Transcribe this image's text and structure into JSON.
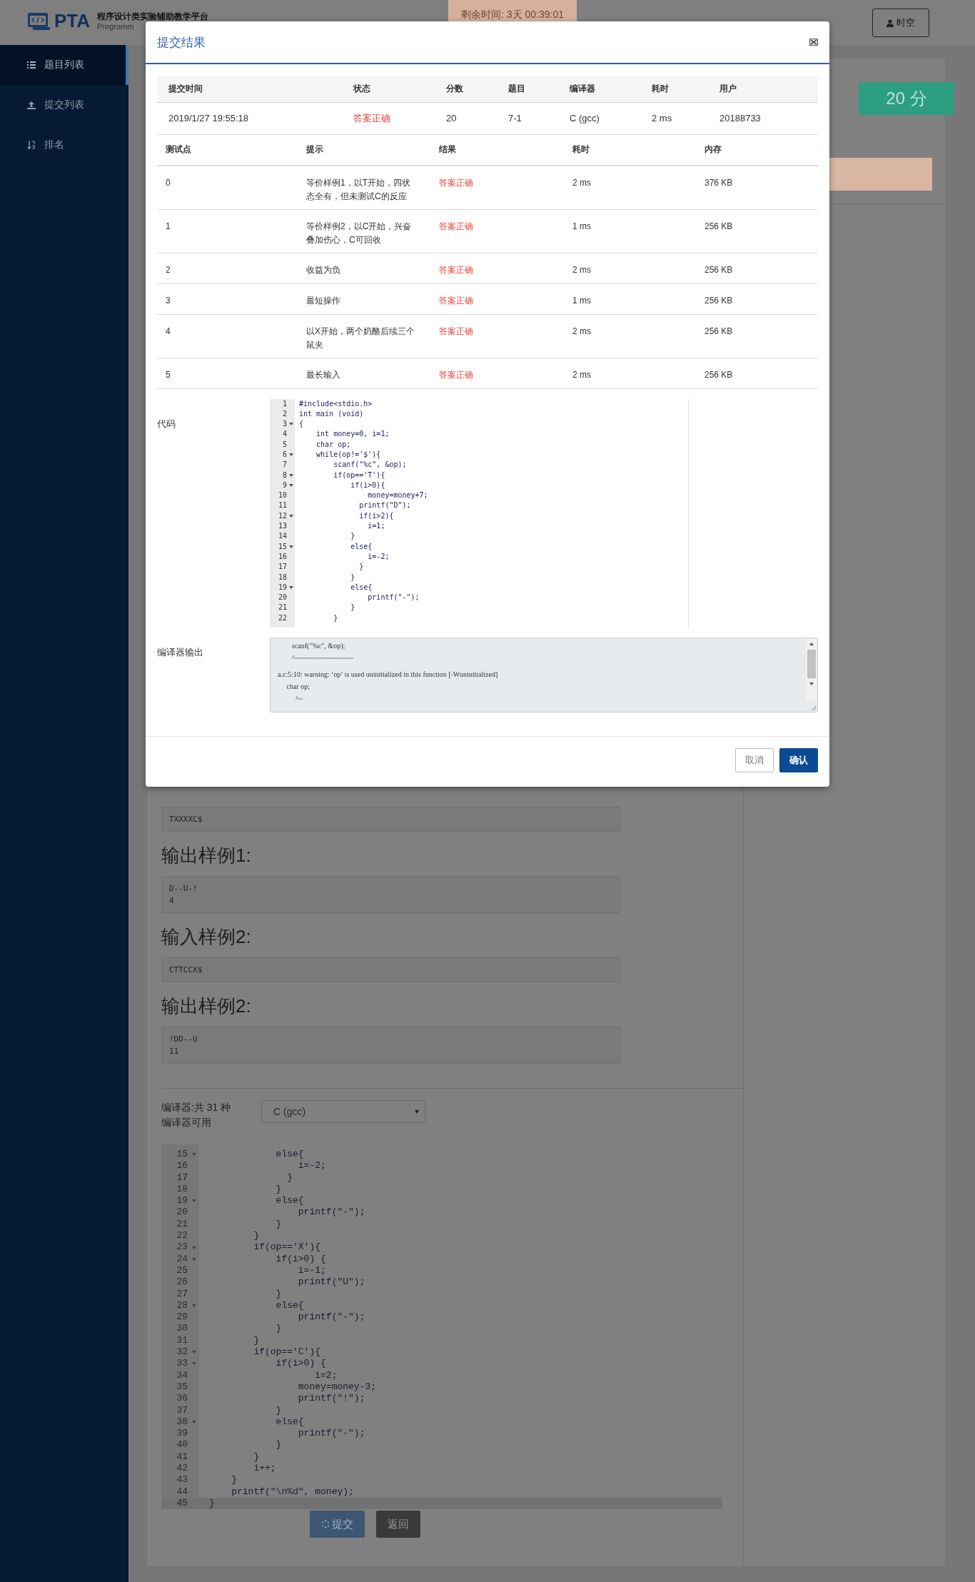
{
  "header": {
    "logo": "PTA",
    "subtitle": "程序设计类实验辅助教学平台",
    "subtitle_en": "Programm",
    "timer": "剩余时间: 3天 00:39:01",
    "user": "时空"
  },
  "sidebar": {
    "items": [
      {
        "label": "题目列表",
        "kind": "list",
        "selected": true
      },
      {
        "label": "提交列表",
        "kind": "upload",
        "selected": false
      },
      {
        "label": "排名",
        "kind": "rank",
        "selected": false
      }
    ]
  },
  "score_badge": "20 分",
  "samples": [
    {
      "kind": "box",
      "lines": [
        "TXXXXC$"
      ]
    },
    {
      "kind": "heading",
      "text": "输出样例1:"
    },
    {
      "kind": "box",
      "lines": [
        "D--U-!",
        "4"
      ]
    },
    {
      "kind": "heading",
      "text": "输入样例2:"
    },
    {
      "kind": "box",
      "lines": [
        "CTTCCX$"
      ]
    },
    {
      "kind": "heading",
      "text": "输出样例2:"
    },
    {
      "kind": "box",
      "lines": [
        "!DD--U",
        "11"
      ]
    }
  ],
  "compiler": {
    "label": "编译器:共 31 种编译器可用",
    "value": "C (gcc)"
  },
  "editor": {
    "lines": [
      {
        "n": "15",
        "fold": true,
        "active": false,
        "code": "            else{"
      },
      {
        "n": "16",
        "fold": false,
        "active": false,
        "code": "                i=-2;"
      },
      {
        "n": "17",
        "fold": false,
        "active": false,
        "code": "              }"
      },
      {
        "n": "18",
        "fold": false,
        "active": false,
        "code": "            }"
      },
      {
        "n": "19",
        "fold": true,
        "active": false,
        "code": "            else{"
      },
      {
        "n": "20",
        "fold": false,
        "active": false,
        "code": "                printf(\"-\");"
      },
      {
        "n": "21",
        "fold": false,
        "active": false,
        "code": "            }"
      },
      {
        "n": "22",
        "fold": false,
        "active": false,
        "code": "        }"
      },
      {
        "n": "23",
        "fold": true,
        "active": false,
        "code": "        if(op=='X'){"
      },
      {
        "n": "24",
        "fold": true,
        "active": false,
        "code": "            if(i>0) {"
      },
      {
        "n": "25",
        "fold": false,
        "active": false,
        "code": "                i=-1;"
      },
      {
        "n": "26",
        "fold": false,
        "active": false,
        "code": "                printf(\"U\");"
      },
      {
        "n": "27",
        "fold": false,
        "active": false,
        "code": "            }"
      },
      {
        "n": "28",
        "fold": true,
        "active": false,
        "code": "            else{"
      },
      {
        "n": "29",
        "fold": false,
        "active": false,
        "code": "                printf(\"-\");"
      },
      {
        "n": "30",
        "fold": false,
        "active": false,
        "code": "            }"
      },
      {
        "n": "31",
        "fold": false,
        "active": false,
        "code": "        }"
      },
      {
        "n": "32",
        "fold": true,
        "active": false,
        "code": "        if(op=='C'){"
      },
      {
        "n": "33",
        "fold": true,
        "active": false,
        "code": "            if(i>0) {"
      },
      {
        "n": "34",
        "fold": false,
        "active": false,
        "code": "                   i=2;"
      },
      {
        "n": "35",
        "fold": false,
        "active": false,
        "code": "                money=money-3;"
      },
      {
        "n": "36",
        "fold": false,
        "active": false,
        "code": "                printf(\"!\");"
      },
      {
        "n": "37",
        "fold": false,
        "active": false,
        "code": "            }"
      },
      {
        "n": "38",
        "fold": true,
        "active": false,
        "code": "            else{"
      },
      {
        "n": "39",
        "fold": false,
        "active": false,
        "code": "                printf(\"-\");"
      },
      {
        "n": "40",
        "fold": false,
        "active": false,
        "code": "            }"
      },
      {
        "n": "41",
        "fold": false,
        "active": false,
        "code": "        }"
      },
      {
        "n": "42",
        "fold": false,
        "active": false,
        "code": "        i++;"
      },
      {
        "n": "43",
        "fold": false,
        "active": false,
        "code": "    }"
      },
      {
        "n": "44",
        "fold": false,
        "active": false,
        "code": "    printf(\"\\n%d\", money);"
      },
      {
        "n": "45",
        "fold": false,
        "active": true,
        "code": "}"
      }
    ]
  },
  "buttons": [
    {
      "label": "提交",
      "kind": "primary"
    },
    {
      "label": "返回",
      "kind": "secondary"
    }
  ],
  "modal": {
    "title": "提交结果",
    "summary": {
      "columns": [
        "提交时间",
        "状态",
        "分数",
        "题目",
        "编译器",
        "耗时",
        "用户"
      ],
      "row": [
        "2019/1/27 19:55:18",
        "答案正确",
        "20",
        "7-1",
        "C (gcc)",
        "2 ms",
        "20188733"
      ]
    },
    "tests": {
      "columns": [
        "测试点",
        "提示",
        "结果",
        "耗时",
        "内存"
      ],
      "rows": [
        [
          "0",
          "等价样例1，以T开始，四状态全有，但未测试C的反应",
          "答案正确",
          "2 ms",
          "376 KB"
        ],
        [
          "1",
          "等价样例2，以C开始，兴奋叠加伤心，C可回收",
          "答案正确",
          "1 ms",
          "256 KB"
        ],
        [
          "2",
          "收益为负",
          "答案正确",
          "2 ms",
          "256 KB"
        ],
        [
          "3",
          "最短操作",
          "答案正确",
          "1 ms",
          "256 KB"
        ],
        [
          "4",
          "以X开始，两个奶酪后续三个鼠夹",
          "答案正确",
          "2 ms",
          "256 KB"
        ],
        [
          "5",
          "最长输入",
          "答案正确",
          "2 ms",
          "256 KB"
        ]
      ]
    },
    "code_label": "代码",
    "code": [
      {
        "n": "1",
        "fold": false,
        "code": "#include<stdio.h>"
      },
      {
        "n": "2",
        "fold": false,
        "code": "int main (void)"
      },
      {
        "n": "3",
        "fold": true,
        "code": "{"
      },
      {
        "n": "4",
        "fold": false,
        "code": "    int money=0, i=1;"
      },
      {
        "n": "5",
        "fold": false,
        "code": "    char op;"
      },
      {
        "n": "6",
        "fold": true,
        "code": "    while(op!='$'){"
      },
      {
        "n": "7",
        "fold": false,
        "code": "        scanf(\"%c\", &op);"
      },
      {
        "n": "8",
        "fold": true,
        "code": "        if(op=='T'){"
      },
      {
        "n": "9",
        "fold": true,
        "code": "            if(i>0){"
      },
      {
        "n": "10",
        "fold": false,
        "code": "                money=money+7;"
      },
      {
        "n": "11",
        "fold": false,
        "code": "              printf(\"D\");"
      },
      {
        "n": "12",
        "fold": true,
        "code": "              if(i>2){"
      },
      {
        "n": "13",
        "fold": false,
        "code": "                i=1;"
      },
      {
        "n": "14",
        "fold": false,
        "code": "            }"
      },
      {
        "n": "15",
        "fold": true,
        "code": "            else{"
      },
      {
        "n": "16",
        "fold": false,
        "code": "                i=-2;"
      },
      {
        "n": "17",
        "fold": false,
        "code": "              }"
      },
      {
        "n": "18",
        "fold": false,
        "code": "            }"
      },
      {
        "n": "19",
        "fold": true,
        "code": "            else{"
      },
      {
        "n": "20",
        "fold": false,
        "code": "                printf(\"-\");"
      },
      {
        "n": "21",
        "fold": false,
        "code": "            }"
      },
      {
        "n": "22",
        "fold": false,
        "code": "        }"
      }
    ],
    "output_label": "编译器输出",
    "output": [
      [
        "        scanf(\"%c\", &op);",
        "        ^~~~~~~~~~~~~~~~"
      ],
      [
        "a.c:5:10: warning: ‘op’ is used uninitialized in this function [-Wuninitialized]",
        "     char op;",
        "          ^~"
      ]
    ],
    "buttons": [
      {
        "label": "取消",
        "kind": "secondary"
      },
      {
        "label": "确认",
        "kind": "primary"
      }
    ]
  }
}
